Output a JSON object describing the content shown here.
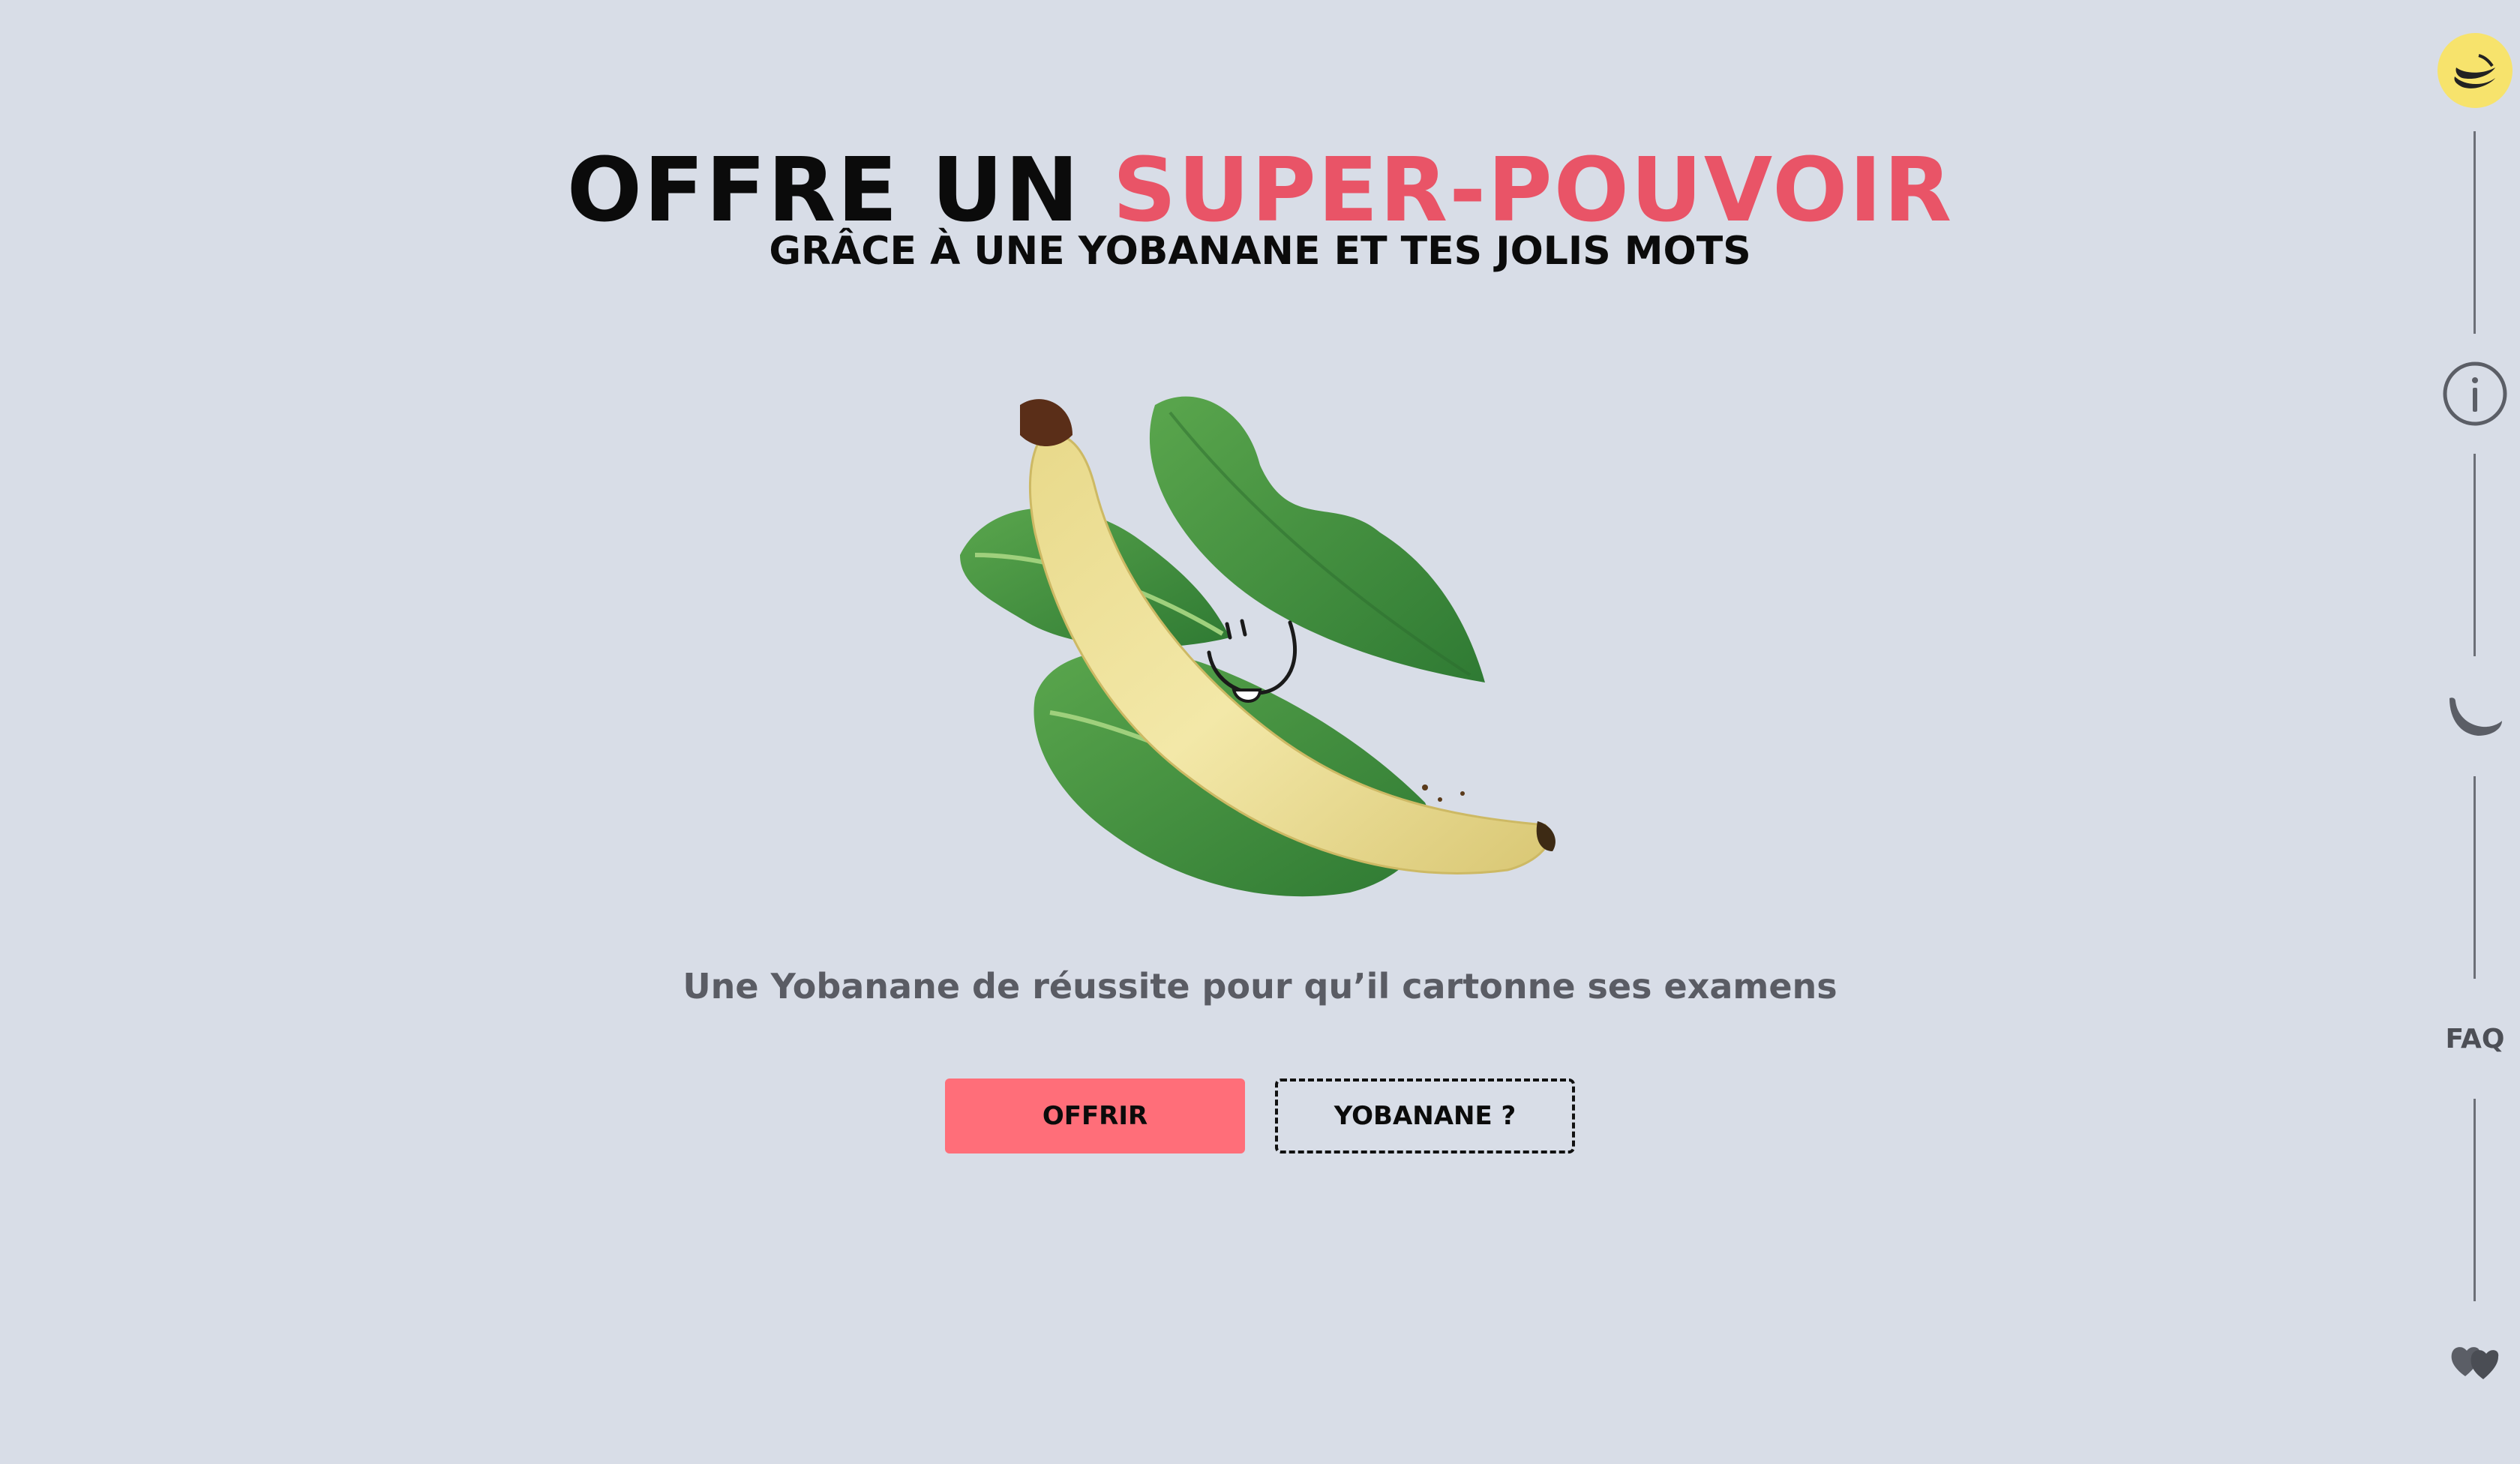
{
  "hero": {
    "title_part1": "OFFRE UN ",
    "title_accent": "SUPER-POUVOIR",
    "subtitle": "GRÂCE À UNE YOBANANE ET TES JOLIS MOTS",
    "tagline": "Une Yobanane de réussite pour qu’il cartonne ses examens",
    "offer_button": "OFFRIR",
    "what_button": "YOBANANE ?"
  },
  "rail": {
    "faq_label": "FAQ",
    "icons": [
      "yobanane-logo-icon",
      "info-icon",
      "banana-icon",
      "faq-link",
      "hearts-icon"
    ]
  },
  "colors": {
    "background": "#d8dde7",
    "accent": "#e95467",
    "button": "#ff6e79",
    "logo_yellow": "#f7e36c",
    "leaf_green": "#3f8f3c",
    "banana_yellow": "#f0e39a"
  }
}
